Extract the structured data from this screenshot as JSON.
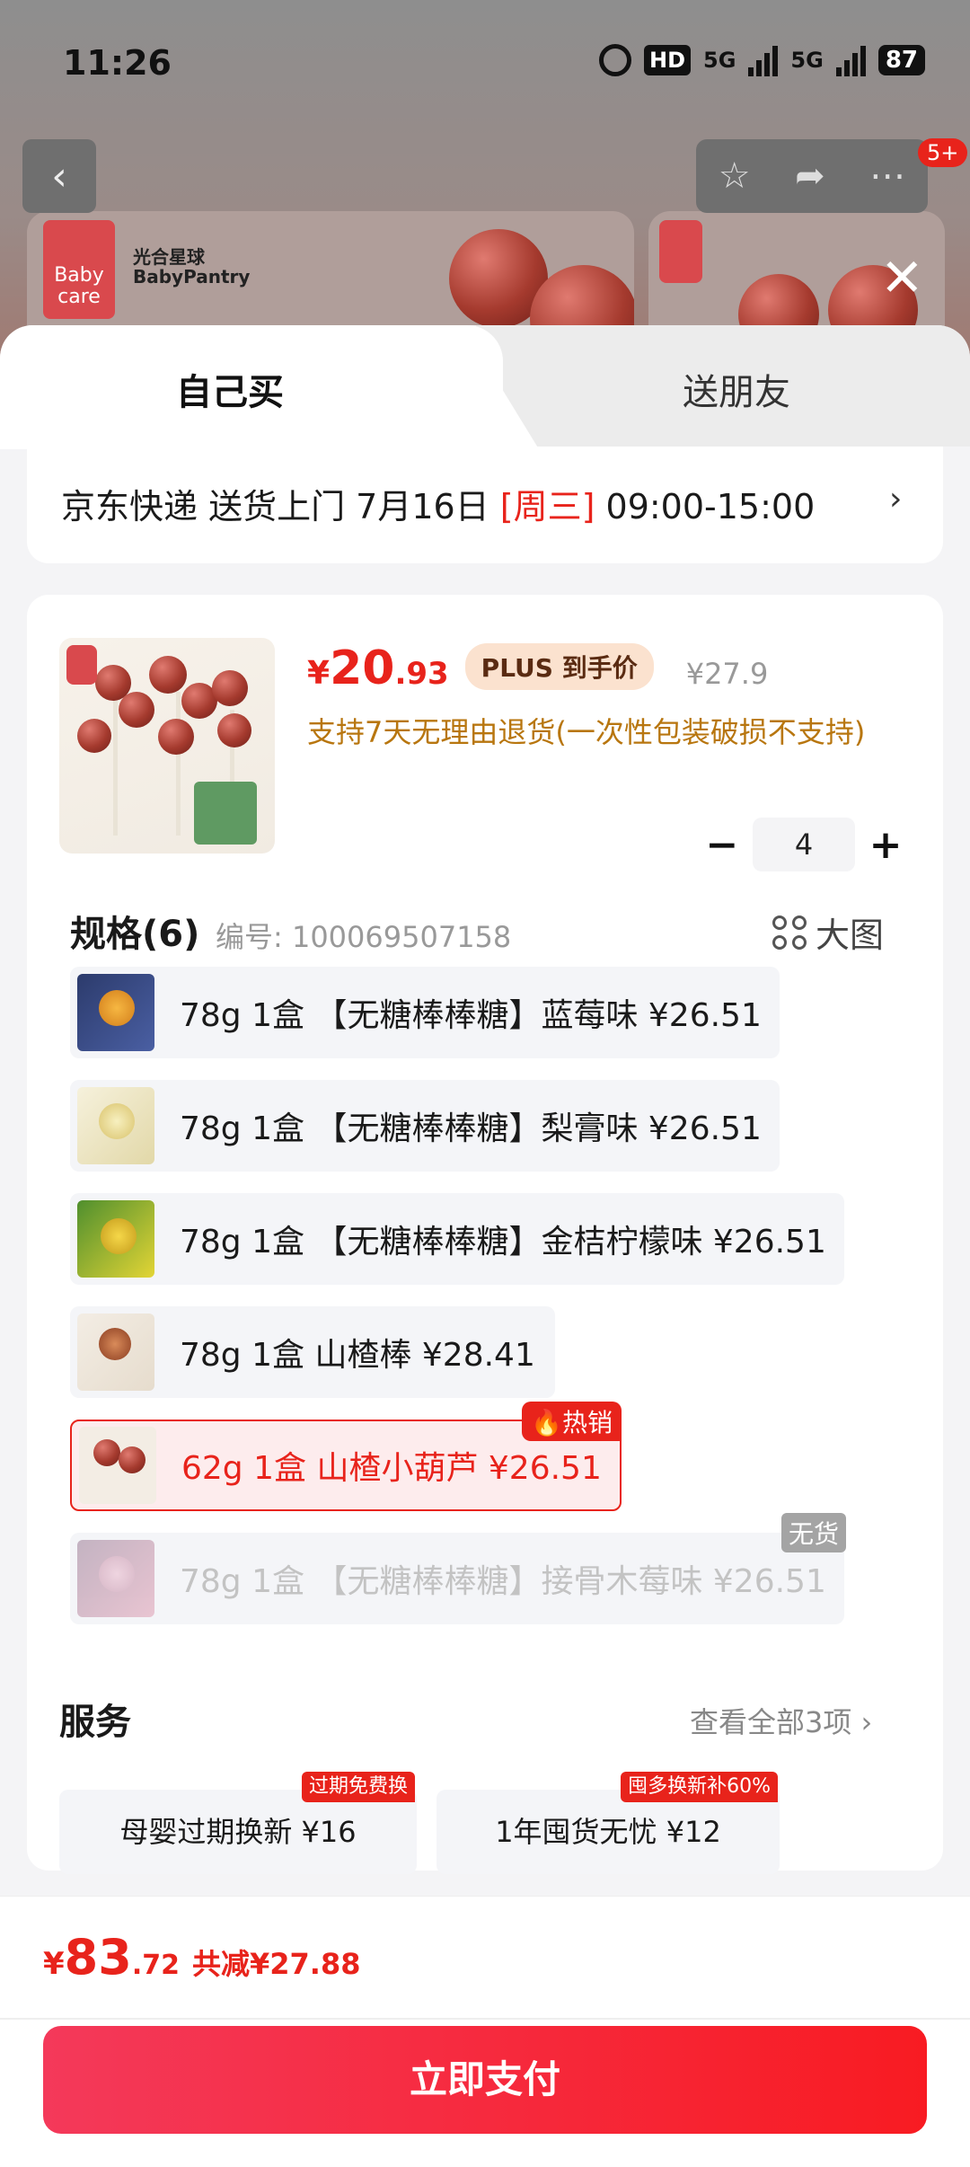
{
  "status_bar": {
    "time": "11:26",
    "hd": "HD",
    "net1": "5G",
    "net2": "5G",
    "battery": "87"
  },
  "topnav": {
    "back_icon": "‹",
    "notif_badge": "5+"
  },
  "brand": {
    "babycare": "Baby care",
    "partner": "光合星球 BabyPantry"
  },
  "tabs": {
    "self": "自己买",
    "friend": "送朋友"
  },
  "delivery": {
    "text_prefix": "京东快递 送货上门 7月16日 ",
    "weekday": "[周三]",
    "time": " 09:00-15:00",
    "chevron": "›"
  },
  "product": {
    "currency": "¥",
    "price_int": "20",
    "price_dec": ".93",
    "plus_label": "PLUS 到手价",
    "original_price": "¥27.9",
    "return_policy": "支持7天无理由退货(一次性包装破损不支持)",
    "qty_minus": "−",
    "qty_value": "4",
    "qty_plus": "+"
  },
  "spec": {
    "title": "规格(6)",
    "code": "编号: 100069507158",
    "bigpic_label": "大图",
    "options": [
      {
        "label": "78g 1盒 【无糖棒棒糖】蓝莓味  ¥26.51",
        "tag": ""
      },
      {
        "label": "78g 1盒 【无糖棒棒糖】梨膏味  ¥26.51",
        "tag": ""
      },
      {
        "label": "78g 1盒 【无糖棒棒糖】金桔柠檬味  ¥26.51",
        "tag": ""
      },
      {
        "label": "78g 1盒 山楂棒  ¥28.41",
        "tag": ""
      },
      {
        "label": "62g 1盒 山楂小葫芦  ¥26.51",
        "tag": "热销"
      },
      {
        "label": "78g 1盒 【无糖棒棒糖】接骨木莓味  ¥26.51",
        "tag": "无货"
      }
    ]
  },
  "service": {
    "title": "服务",
    "view_all": "查看全部3项 ›",
    "items": [
      {
        "label": "母婴过期换新  ¥16",
        "tag": "过期免费换"
      },
      {
        "label": "1年囤货无忧  ¥12",
        "tag": "囤多换新补60%"
      }
    ]
  },
  "footer": {
    "currency": "¥",
    "total_int": "83",
    "total_dec": ".72",
    "reduce": "共减¥27.88",
    "pay_label": "立即支付"
  },
  "colors": {
    "accent": "#e8231b",
    "plus_bg": "#fbe2cf",
    "return_text": "#b8760f"
  }
}
